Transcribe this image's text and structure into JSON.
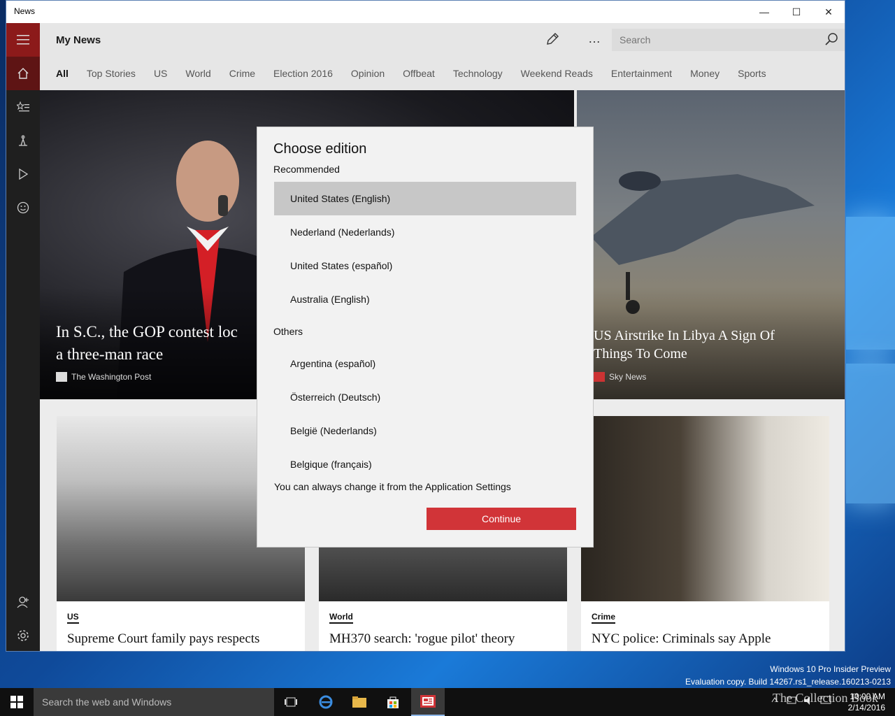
{
  "window": {
    "title": "News",
    "min": "—",
    "max": "☐",
    "close": "✕"
  },
  "header": {
    "title": "My News",
    "search_placeholder": "Search",
    "edit_icon": "pencil-icon",
    "more_icon": "…",
    "search_icon": "⌕"
  },
  "tabs": [
    "All",
    "Top Stories",
    "US",
    "World",
    "Crime",
    "Election 2016",
    "Opinion",
    "Offbeat",
    "Technology",
    "Weekend Reads",
    "Entertainment",
    "Money",
    "Sports"
  ],
  "hero": [
    {
      "title_line1": "In S.C., the GOP contest loc",
      "title_line2": "a three-man race",
      "source": "The Washington Post"
    },
    {
      "title_line1": "US Airstrike In Libya A Sign Of",
      "title_line2": "Things To Come",
      "source": "Sky News"
    }
  ],
  "cards": [
    {
      "category": "US",
      "headline": "Supreme Court family pays respects"
    },
    {
      "category": "World",
      "headline": "MH370 search: 'rogue pilot' theory"
    },
    {
      "category": "Crime",
      "headline": "NYC police: Criminals say Apple"
    }
  ],
  "dialog": {
    "title": "Choose edition",
    "recommended_label": "Recommended",
    "recommended": [
      "United States (English)",
      "Nederland (Nederlands)",
      "United States (español)",
      "Australia (English)"
    ],
    "others_label": "Others",
    "others": [
      "Argentina (español)",
      "Österreich (Deutsch)",
      "België (Nederlands)",
      "Belgique (français)"
    ],
    "note": "You can always change it from the Application Settings",
    "continue_label": "Continue",
    "selected_index": 0
  },
  "watermark": {
    "line1": "Windows 10 Pro Insider Preview",
    "line2": "Evaluation copy. Build 14267.rs1_release.160213-0213"
  },
  "taskbar": {
    "search_placeholder": "Search the web and Windows",
    "time": "10:00 AM",
    "date": "2/14/2016"
  },
  "brand": "The Collection Book",
  "colors": {
    "accent_red": "#d13438",
    "rail_dark": "#1f1f1f",
    "rail_red": "#8c1a1a"
  }
}
